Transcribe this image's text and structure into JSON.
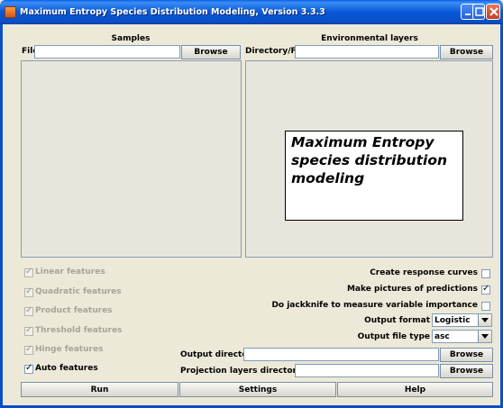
{
  "window": {
    "title": "Maximum Entropy Species Distribution Modeling, Version 3.3.3"
  },
  "samples": {
    "header": "Samples",
    "file_label": "File",
    "file_value": "",
    "browse_label": "Browse"
  },
  "env": {
    "header": "Environmental layers",
    "dir_label": "Directory/File",
    "dir_value": "",
    "browse_label": "Browse"
  },
  "overlay_text": "Maximum Entropy species distribution modeling",
  "features": [
    {
      "label": "Linear features",
      "checked": true,
      "enabled": false
    },
    {
      "label": "Quadratic features",
      "checked": true,
      "enabled": false
    },
    {
      "label": "Product features",
      "checked": true,
      "enabled": false
    },
    {
      "label": "Threshold features",
      "checked": true,
      "enabled": false
    },
    {
      "label": "Hinge features",
      "checked": true,
      "enabled": false
    },
    {
      "label": "Auto features",
      "checked": true,
      "enabled": true
    }
  ],
  "options": {
    "response_curves": "Create response curves",
    "response_curves_checked": false,
    "pictures": "Make pictures of predictions",
    "pictures_checked": true,
    "jackknife": "Do jackknife to measure variable importance",
    "jackknife_checked": false,
    "output_format_label": "Output format",
    "output_format_value": "Logistic",
    "output_file_type_label": "Output file type",
    "output_file_type_value": "asc"
  },
  "output": {
    "dir_label": "Output directory",
    "dir_value": "",
    "proj_label": "Projection layers directory/file",
    "proj_value": "",
    "browse_label": "Browse"
  },
  "bottom": {
    "run": "Run",
    "settings": "Settings",
    "help": "Help"
  },
  "icons": {
    "app": "maxent-app-icon",
    "minimize": "minimize-icon",
    "maximize": "maximize-icon",
    "close": "close-icon",
    "dropdown": "chevron-down-icon"
  }
}
